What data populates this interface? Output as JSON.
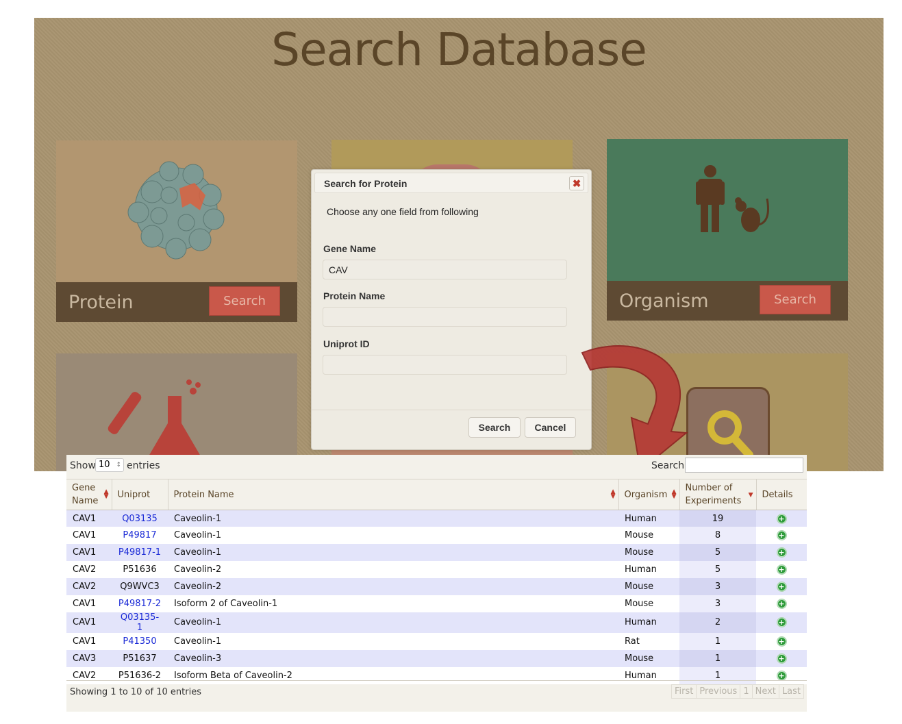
{
  "page": {
    "title": "Search Database",
    "tiles": [
      {
        "label": "Protein",
        "button": "Search"
      },
      {
        "label": "Organism",
        "button": "Search"
      }
    ]
  },
  "modal": {
    "title": "Search for Protein",
    "close_icon": "close-x-icon",
    "intro": "Choose any one field from following",
    "gene_label": "Gene Name",
    "gene_value": "CAV",
    "protein_label": "Protein Name",
    "protein_value": "",
    "uniprot_label": "Uniprot ID",
    "uniprot_value": "",
    "search_button": "Search",
    "cancel_button": "Cancel"
  },
  "table_panel": {
    "show_label": "Show",
    "length_value": "10",
    "entries_label": "entries",
    "search_label": "Search:",
    "search_value": "",
    "columns": [
      "Gene Name",
      "Uniprot",
      "Protein Name",
      "Organism",
      "Number of Experiments",
      "Details"
    ],
    "rows": [
      {
        "gene": "CAV1",
        "uniprot": "Q03135",
        "protein": "Caveolin-1",
        "organism": "Human",
        "experiments": "19"
      },
      {
        "gene": "CAV1",
        "uniprot": "P49817",
        "protein": "Caveolin-1",
        "organism": "Mouse",
        "experiments": "8"
      },
      {
        "gene": "CAV1",
        "uniprot": "P49817-1",
        "protein": "Caveolin-1",
        "organism": "Mouse",
        "experiments": "5"
      },
      {
        "gene": "CAV2",
        "uniprot": "P51636",
        "protein": "Caveolin-2",
        "organism": "Human",
        "experiments": "5"
      },
      {
        "gene": "CAV2",
        "uniprot": "Q9WVC3",
        "protein": "Caveolin-2",
        "organism": "Mouse",
        "experiments": "3"
      },
      {
        "gene": "CAV1",
        "uniprot": "P49817-2",
        "protein": "Isoform 2 of Caveolin-1",
        "organism": "Mouse",
        "experiments": "3"
      },
      {
        "gene": "CAV1",
        "uniprot": "Q03135-1",
        "protein": "Caveolin-1",
        "organism": "Human",
        "experiments": "2"
      },
      {
        "gene": "CAV1",
        "uniprot": "P41350",
        "protein": "Caveolin-1",
        "organism": "Rat",
        "experiments": "1"
      },
      {
        "gene": "CAV3",
        "uniprot": "P51637",
        "protein": "Caveolin-3",
        "organism": "Mouse",
        "experiments": "1"
      },
      {
        "gene": "CAV2",
        "uniprot": "P51636-2",
        "protein": "Isoform Beta of Caveolin-2",
        "organism": "Human",
        "experiments": "1"
      }
    ],
    "info": "Showing 1 to 10 of 10 entries",
    "pager": [
      "First",
      "Previous",
      "1",
      "Next",
      "Last"
    ],
    "link_color": "#1a2ad6",
    "detail_icon": "plus-circle-icon"
  }
}
